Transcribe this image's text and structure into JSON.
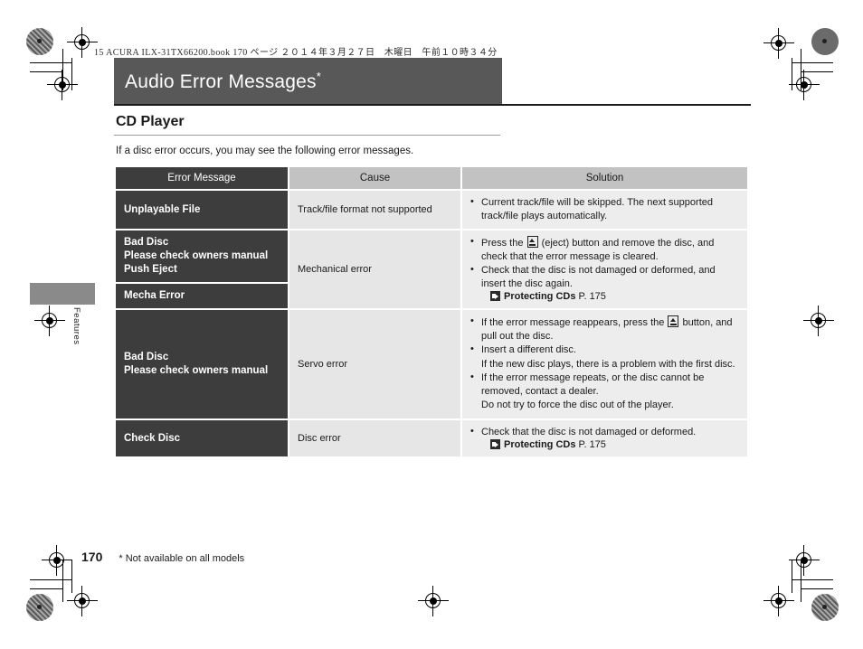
{
  "print_header": "15 ACURA ILX-31TX66200.book   170 ページ   ２０１４年３月２７日　木曜日　午前１０時３４分",
  "title": {
    "text": "Audio Error Messages",
    "asterisk": "*"
  },
  "section": {
    "heading": "CD Player",
    "intro": "If a disc error occurs, you may see the following error messages."
  },
  "table": {
    "columns": [
      "Error Message",
      "Cause",
      "Solution"
    ],
    "rows": [
      {
        "messages": [
          "Unplayable File"
        ],
        "cause": "Track/file format not supported",
        "solution": [
          {
            "type": "bullet",
            "text": "Current track/file will be skipped. The next supported track/file plays automatically."
          }
        ]
      },
      {
        "messages": [
          "Bad Disc\nPlease check owners manual\nPush Eject",
          "Mecha Error"
        ],
        "cause": "Mechanical error",
        "solution": [
          {
            "type": "bullet_eject",
            "pre": "Press the ",
            "post": " (eject) button and remove the disc, and check that the error message is cleared."
          },
          {
            "type": "bullet",
            "text": "Check that the disc is not damaged or deformed, and insert the disc again."
          },
          {
            "type": "xref",
            "name": "Protecting CDs",
            "page": "P. 175"
          }
        ]
      },
      {
        "messages": [
          "Bad Disc\nPlease check owners manual"
        ],
        "cause": "Servo error",
        "solution": [
          {
            "type": "bullet_eject",
            "pre": "If the error message reappears, press the ",
            "post": " button, and pull out the disc."
          },
          {
            "type": "bullet",
            "text": "Insert a different disc."
          },
          {
            "type": "plain",
            "text": "If the new disc plays, there is a problem with the first disc."
          },
          {
            "type": "bullet",
            "text": "If the error message repeats, or the disc cannot be removed, contact a dealer."
          },
          {
            "type": "plain",
            "text": "Do not try to force the disc out of the player."
          }
        ]
      },
      {
        "messages": [
          "Check Disc"
        ],
        "cause": "Disc error",
        "solution": [
          {
            "type": "bullet",
            "text": "Check that the disc is not damaged or deformed."
          },
          {
            "type": "xref",
            "name": "Protecting CDs",
            "page": "P. 175"
          }
        ]
      }
    ]
  },
  "side_tab_label": "Features",
  "footer": {
    "page_number": "170",
    "footnote": "* Not available on all models"
  },
  "colors": {
    "title_bar": "#585858",
    "header_dark": "#3d3d3d",
    "header_gray": "#c2c2c2",
    "cause_bg": "#e6e6e6",
    "solution_bg": "#ededed",
    "side_tab": "#8a8a8a"
  }
}
